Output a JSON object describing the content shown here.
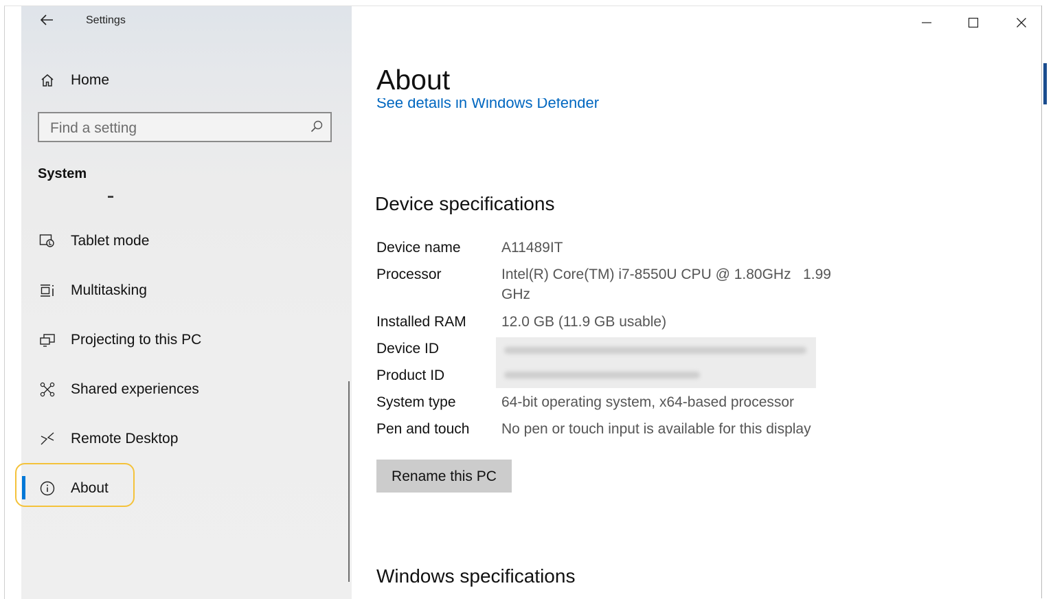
{
  "titlebar": {
    "back_icon": "back-arrow-icon",
    "title": "Settings"
  },
  "window_controls": {
    "minimize": "–",
    "maximize": "☐",
    "close": "✕"
  },
  "sidebar": {
    "home_label": "Home",
    "search_placeholder": "Find a setting",
    "section_title": "System",
    "items": [
      {
        "label": "Tablet mode",
        "icon": "tablet-mode-icon"
      },
      {
        "label": "Multitasking",
        "icon": "multitasking-icon"
      },
      {
        "label": "Projecting to this PC",
        "icon": "projecting-icon"
      },
      {
        "label": "Shared experiences",
        "icon": "shared-experiences-icon"
      },
      {
        "label": "Remote Desktop",
        "icon": "remote-desktop-icon"
      },
      {
        "label": "About",
        "icon": "info-icon",
        "selected": true
      }
    ],
    "accent_color": "#0078d7",
    "highlight_color": "#f4c23a"
  },
  "main": {
    "title": "About",
    "clipped_link": "See details in Windows Defender",
    "device_specs": {
      "heading": "Device specifications",
      "rows": [
        {
          "label": "Device name",
          "value": "A11489IT"
        },
        {
          "label": "Processor",
          "value": "Intel(R) Core(TM) i7-8550U CPU @ 1.80GHz   1.99",
          "value2": "GHz"
        },
        {
          "label": "Installed RAM",
          "value": "12.0 GB (11.9 GB usable)"
        },
        {
          "label": "Device ID",
          "value": ""
        },
        {
          "label": "Product ID",
          "value": ""
        },
        {
          "label": "System type",
          "value": "64-bit operating system, x64-based processor"
        },
        {
          "label": "Pen and touch",
          "value": "No pen or touch input is available for this display"
        }
      ]
    },
    "rename_button": "Rename this PC",
    "windows_specs_heading": "Windows specifications"
  }
}
